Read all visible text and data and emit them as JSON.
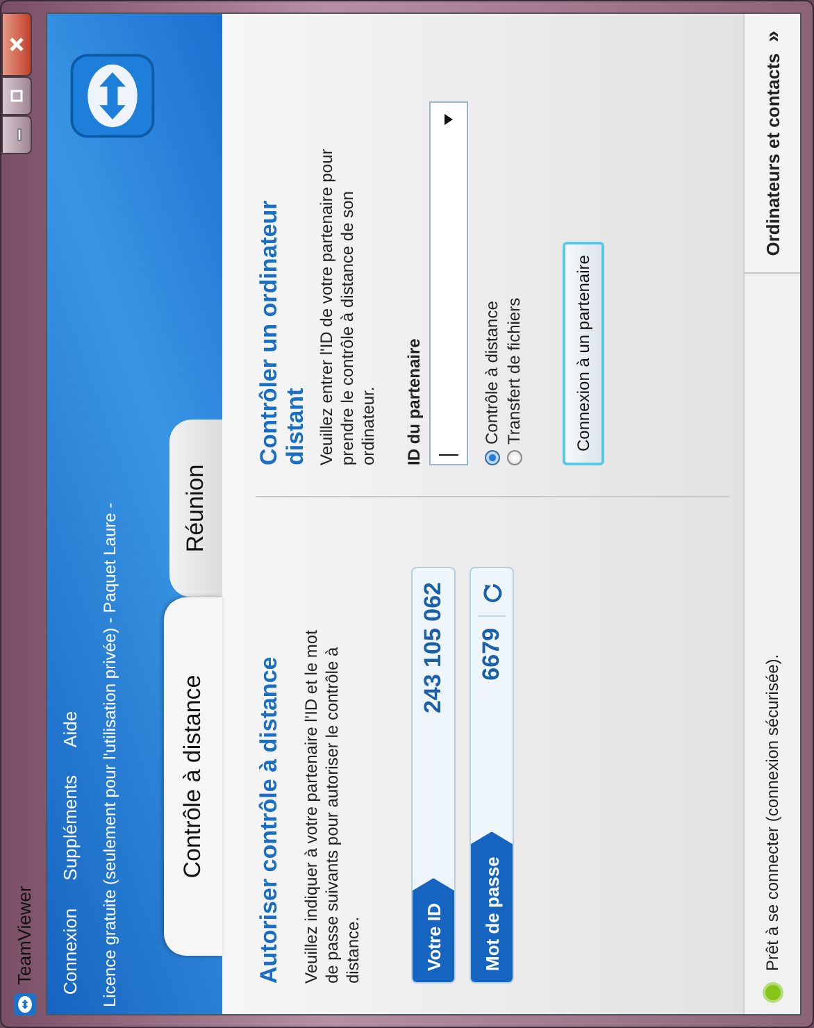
{
  "window": {
    "title": "TeamViewer"
  },
  "menu": [
    "Connexion",
    "Suppléments",
    "Aide"
  ],
  "license": "Licence gratuite (seulement pour l'utilisation privée) - Paquet Laure -",
  "tabs": [
    {
      "label": "Contrôle à distance",
      "selected": true
    },
    {
      "label": "Réunion",
      "selected": false
    }
  ],
  "allow": {
    "heading": "Autoriser contrôle à distance",
    "description": "Veuillez indiquer à votre partenaire l'ID et le mot de passe suivants pour autoriser le contrôle à distance.",
    "fields": [
      {
        "label": "Votre ID",
        "value": "243 105 062",
        "kind": "plain"
      },
      {
        "label": "Mot de passe",
        "value": "6679",
        "kind": "refresh"
      }
    ]
  },
  "control": {
    "heading": "Contrôler un ordinateur distant",
    "description": "Veuillez entrer l'ID de votre partenaire pour prendre le contrôle à distance de son ordinateur.",
    "partner_label": "ID du partenaire",
    "modes": [
      {
        "label": "Contrôle à distance",
        "selected": true
      },
      {
        "label": "Transfert de fichiers",
        "selected": false
      }
    ],
    "connect_button": "Connexion à un partenaire"
  },
  "status_bar": {
    "text": "Prêt à se connecter (connexion sécurisée).",
    "contacts_button": "Ordinateurs et contacts",
    "contacts_glyph": "»"
  }
}
